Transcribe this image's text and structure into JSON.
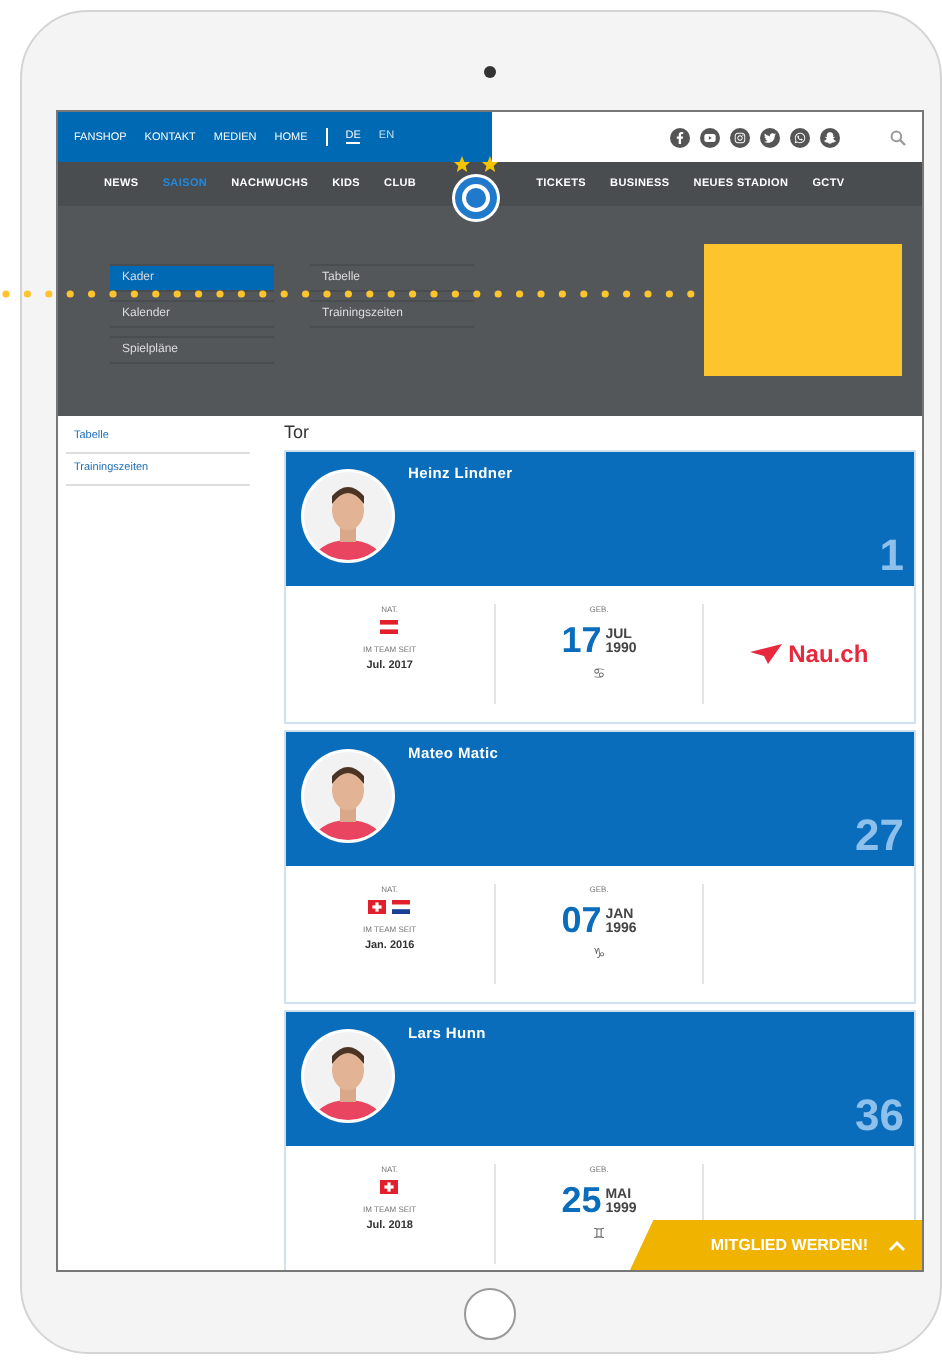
{
  "top_bar": {
    "links": [
      "FANSHOP",
      "KONTAKT",
      "MEDIEN",
      "HOME"
    ],
    "languages": [
      {
        "label": "DE",
        "selected": true
      },
      {
        "label": "EN",
        "selected": false
      }
    ]
  },
  "main_nav": {
    "left": [
      {
        "label": "NEWS",
        "selected": false
      },
      {
        "label": "SAISON",
        "selected": true
      },
      {
        "label": "NACHWUCHS",
        "selected": false
      },
      {
        "label": "KIDS",
        "selected": false
      },
      {
        "label": "CLUB",
        "selected": false
      }
    ],
    "right": [
      {
        "label": "TICKETS",
        "selected": false
      },
      {
        "label": "BUSINESS",
        "selected": false
      },
      {
        "label": "NEUES STADION",
        "selected": false
      },
      {
        "label": "GCTV",
        "selected": false
      }
    ]
  },
  "dropdown": {
    "columns": [
      [
        {
          "label": "Kader",
          "selected": true
        },
        {
          "label": "Kalender",
          "selected": false
        },
        {
          "label": "Spielpläne",
          "selected": false
        }
      ],
      [
        {
          "label": "Tabelle",
          "selected": false
        },
        {
          "label": "Trainingszeiten",
          "selected": false
        }
      ]
    ]
  },
  "sidebar": {
    "items": [
      "Tabelle",
      "Trainingszeiten"
    ]
  },
  "section_title": "Tor",
  "players": [
    {
      "name": "Heinz Lindner",
      "number": "1",
      "nat_label": "NAT.",
      "flags": [
        {
          "kind": "austria"
        }
      ],
      "since_label": "IM TEAM SEIT",
      "since": "Jul. 2017",
      "born_label": "GEB.",
      "day": "17",
      "month": "JUL",
      "year": "1990",
      "sign": "♋",
      "sponsor": "Nau.ch"
    },
    {
      "name": "Mateo Matic",
      "number": "27",
      "nat_label": "NAT.",
      "flags": [
        {
          "kind": "switzerland"
        },
        {
          "kind": "croatia"
        }
      ],
      "since_label": "IM TEAM SEIT",
      "since": "Jan. 2016",
      "born_label": "GEB.",
      "day": "07",
      "month": "JAN",
      "year": "1996",
      "sign": "♑"
    },
    {
      "name": "Lars Hunn",
      "number": "36",
      "nat_label": "NAT.",
      "flags": [
        {
          "kind": "switzerland"
        }
      ],
      "since_label": "IM TEAM SEIT",
      "since": "Jul. 2018",
      "born_label": "GEB.",
      "day": "25",
      "month": "MAI",
      "year": "1999",
      "sign": "♊"
    }
  ],
  "cta": {
    "label": "MITGLIED WERDEN!"
  }
}
